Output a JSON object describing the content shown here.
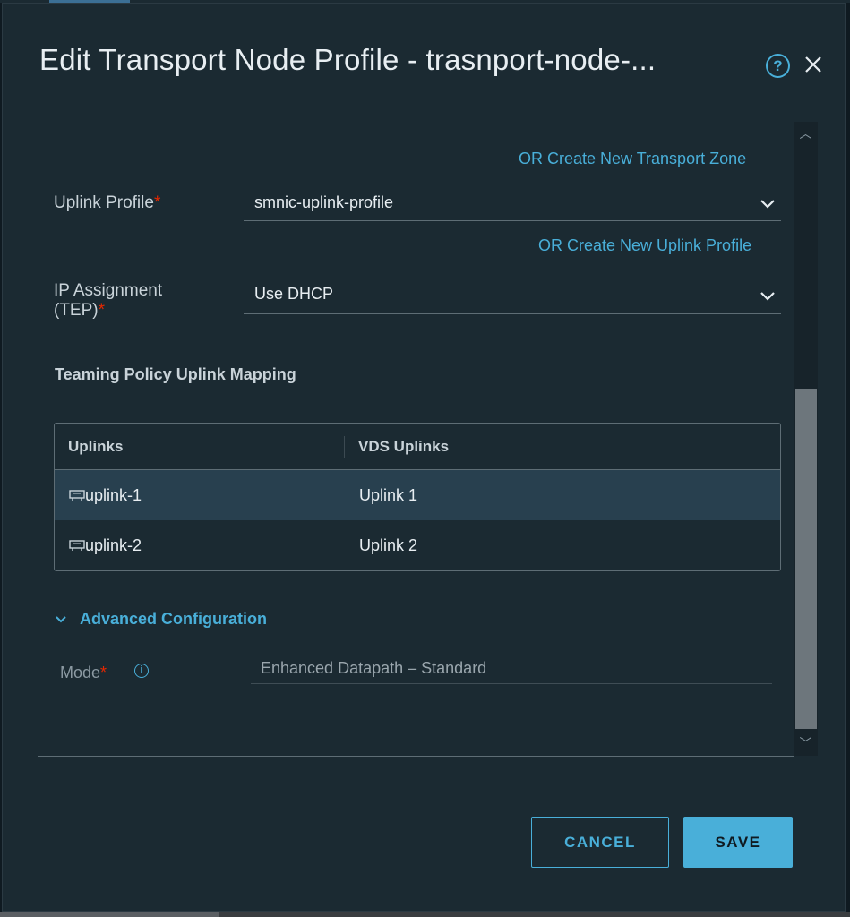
{
  "modal": {
    "title": "Edit Transport Node Profile - trasnport-node-..."
  },
  "form": {
    "transport_zone_link": "OR Create New Transport Zone",
    "uplink_profile": {
      "label": "Uplink Profile",
      "required": "*",
      "value": "smnic-uplink-profile",
      "link": "OR Create New Uplink Profile"
    },
    "ip_assignment": {
      "label_line1": "IP Assignment",
      "label_line2": "(TEP)",
      "required": "*",
      "value": "Use DHCP"
    }
  },
  "teaming": {
    "title": "Teaming Policy Uplink Mapping",
    "columns": [
      "Uplinks",
      "VDS Uplinks"
    ],
    "rows": [
      {
        "uplink": "uplink-1",
        "vds_uplink": "Uplink 1",
        "selected": true
      },
      {
        "uplink": "uplink-2",
        "vds_uplink": "Uplink 2",
        "selected": false
      }
    ]
  },
  "advanced": {
    "label": "Advanced Configuration",
    "mode": {
      "label": "Mode",
      "required": "*",
      "value": "Enhanced Datapath – Standard"
    }
  },
  "buttons": {
    "cancel": "CANCEL",
    "save": "SAVE"
  },
  "icons": {
    "help": "help-icon",
    "close": "close-icon",
    "info": "info-icon",
    "uplink": "uplink-icon"
  },
  "colors": {
    "accent": "#49afd9",
    "background": "#1b2a32",
    "required": "#e62700",
    "selected_row": "#28404f"
  }
}
